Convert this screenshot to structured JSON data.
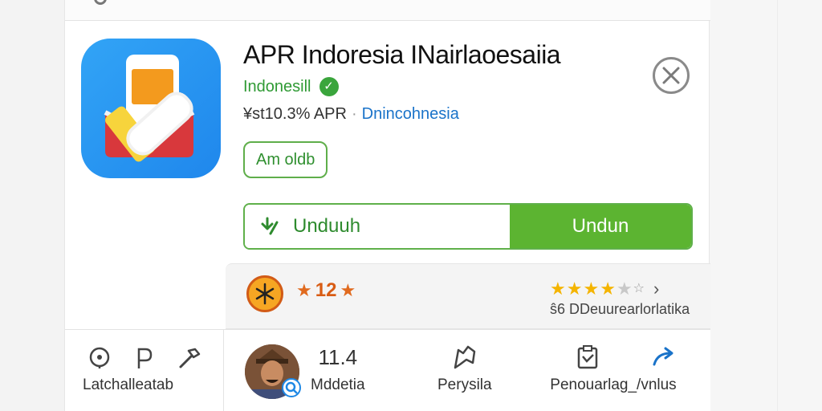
{
  "app": {
    "title": "APR Indoresia INairlaoesaiia",
    "developer": "Indonesill",
    "verified_mark": "✓",
    "meta_text": "¥st10.3% APR",
    "meta_separator": "·",
    "meta_link": "Dnincohnesia",
    "badge": "Am oldb"
  },
  "download": {
    "secondary_label": "Unduuh",
    "primary_label": "Undun"
  },
  "rating": {
    "score_prefix": "★",
    "score": "12",
    "score_suffix": "★",
    "stars_filled": 4,
    "stars_total": 6,
    "caption": "ŝ6 DDeuurearlorlatika"
  },
  "bottom_nav": {
    "left_label": "Latchalleatab",
    "count": "11.4",
    "items": [
      {
        "label": "Mddetia"
      },
      {
        "label": "Perysila"
      },
      {
        "label": "Penouarlag_/vnlus"
      }
    ]
  },
  "colors": {
    "accent_green": "#5cb431",
    "link_blue": "#1a73c9",
    "star_gold": "#f4b400",
    "rating_orange": "#d85c14"
  },
  "icons": [
    "search-icon",
    "app-icon",
    "verified-icon",
    "close-icon",
    "download-icon",
    "rating-icon",
    "star-icon",
    "chevron-right-icon",
    "location-pin-icon",
    "p-icon",
    "hammer-icon",
    "avatar",
    "flag-icon",
    "clipboard-icon",
    "share-icon"
  ]
}
